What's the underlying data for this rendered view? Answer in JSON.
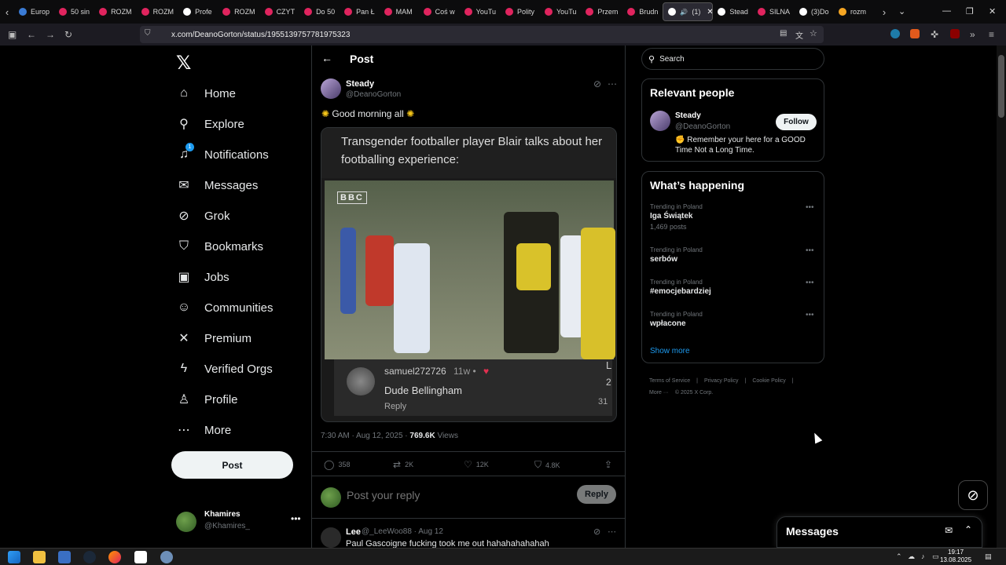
{
  "browser": {
    "tabs": [
      {
        "label": "Europ",
        "color": "#3a7bd5"
      },
      {
        "label": "50 sin",
        "color": "#e0245e"
      },
      {
        "label": "ROZM",
        "color": "#e0245e"
      },
      {
        "label": "ROZM",
        "color": "#e0245e"
      },
      {
        "label": "Profe",
        "color": "#ffffff"
      },
      {
        "label": "ROZM",
        "color": "#e0245e"
      },
      {
        "label": "CZYT",
        "color": "#e0245e"
      },
      {
        "label": "Do 50",
        "color": "#e0245e"
      },
      {
        "label": "Pan Ł",
        "color": "#e0245e"
      },
      {
        "label": "MAM",
        "color": "#e0245e"
      },
      {
        "label": "Coś w",
        "color": "#e0245e"
      },
      {
        "label": "YouTu",
        "color": "#e0245e"
      },
      {
        "label": "Polity",
        "color": "#e0245e"
      },
      {
        "label": "YouTu",
        "color": "#e0245e"
      },
      {
        "label": "Przem",
        "color": "#e0245e"
      },
      {
        "label": "Brudn",
        "color": "#e0245e"
      },
      {
        "label": "(1)",
        "color": "#ffffff",
        "active": true
      },
      {
        "label": "Stead",
        "color": "#ffffff"
      },
      {
        "label": "SILNA",
        "color": "#e0245e"
      },
      {
        "label": "(3)Do",
        "color": "#ffffff"
      },
      {
        "label": "rozm",
        "color": "#f5a623"
      }
    ],
    "url": "x.com/DeanoGorton/status/1955139757781975323"
  },
  "nav": {
    "items": [
      {
        "label": "Home",
        "icon": "home-icon",
        "glyph": "⌂"
      },
      {
        "label": "Explore",
        "icon": "search-icon",
        "glyph": "⚲"
      },
      {
        "label": "Notifications",
        "icon": "bell-icon",
        "glyph": "♫"
      },
      {
        "label": "Messages",
        "icon": "envelope-icon",
        "glyph": "✉"
      },
      {
        "label": "Grok",
        "icon": "grok-icon",
        "glyph": "⊘"
      },
      {
        "label": "Bookmarks",
        "icon": "bookmark-icon",
        "glyph": "⛉"
      },
      {
        "label": "Jobs",
        "icon": "briefcase-icon",
        "glyph": "▣"
      },
      {
        "label": "Communities",
        "icon": "people-icon",
        "glyph": "☺"
      },
      {
        "label": "Premium",
        "icon": "x-icon",
        "glyph": "✕"
      },
      {
        "label": "Verified Orgs",
        "icon": "lightning-icon",
        "glyph": "ϟ"
      },
      {
        "label": "Profile",
        "icon": "person-icon",
        "glyph": "♙"
      },
      {
        "label": "More",
        "icon": "more-circle-icon",
        "glyph": "⋯"
      }
    ],
    "notification_count": "1",
    "post_label": "Post",
    "account": {
      "name": "Khamires",
      "handle": "@Khamires_"
    }
  },
  "post": {
    "header_title": "Post",
    "author_name": "Steady",
    "author_handle": "@DeanoGorton",
    "text": "Good morning all",
    "media_title": "Transgender footballer player Blair talks about her footballing experience:",
    "media_watermark": "BBC",
    "media_comment": {
      "user": "samuel272726",
      "time": "11w •",
      "text": "Dude Bellingham",
      "reply": "Reply",
      "edge1": "L",
      "edge2": "2",
      "edge3": "31"
    },
    "timestamp": "7:30 AM · Aug 12, 2025 · ",
    "views": "769.6K",
    "views_label": " Views",
    "stats": {
      "replies": "358",
      "reposts": "2K",
      "likes": "12K",
      "bookmarks": "4.8K"
    },
    "reply_placeholder": "Post your reply",
    "reply_button": "Reply"
  },
  "next_reply": {
    "name": "Lee",
    "meta": "@_LeeWoo88 · Aug 12",
    "text": "Paul Gascoigne fucking took me out hahahahahahah"
  },
  "sidebar": {
    "search_placeholder": "Search",
    "relevant_title": "Relevant people",
    "person": {
      "name": "Steady",
      "handle": "@DeanoGorton",
      "bio": "Remember your here for a GOOD Time Not a Long Time.",
      "follow": "Follow"
    },
    "happening_title": "What’s happening",
    "trends": [
      {
        "loc": "Trending in Poland",
        "topic": "Iga Świątek",
        "count": "1,469 posts"
      },
      {
        "loc": "Trending in Poland",
        "topic": "serbów",
        "count": ""
      },
      {
        "loc": "Trending in Poland",
        "topic": "#emocjebardziej",
        "count": ""
      },
      {
        "loc": "Trending in Poland",
        "topic": "wpłacone",
        "count": ""
      }
    ],
    "show_more": "Show more",
    "footer": [
      "Terms of Service",
      "|",
      "Privacy Policy",
      "|",
      "Cookie Policy",
      "|"
    ],
    "footer2": [
      "More ···",
      "© 2025 X Corp."
    ]
  },
  "messages_drawer": {
    "title": "Messages"
  },
  "taskbar": {
    "time": "19:17",
    "date": "13.08.2025"
  },
  "colors": {
    "accent": "#1d9bf0",
    "background": "#000000",
    "border": "#2f3336",
    "muted": "#71767b"
  }
}
